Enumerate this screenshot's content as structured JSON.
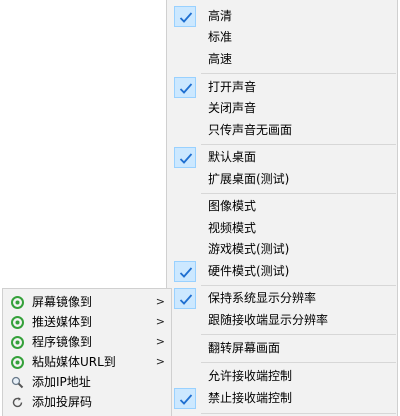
{
  "main_menu": {
    "items": [
      {
        "label": "高清",
        "checked": true
      },
      {
        "label": "标准",
        "checked": false
      },
      {
        "label": "高速",
        "checked": false
      },
      {
        "label": "打开声音",
        "checked": true
      },
      {
        "label": "关闭声音",
        "checked": false
      },
      {
        "label": "只传声音无画面",
        "checked": false
      },
      {
        "label": "默认桌面",
        "checked": true
      },
      {
        "label": "扩展桌面(测试)",
        "checked": false
      },
      {
        "label": "图像模式",
        "checked": false
      },
      {
        "label": "视频模式",
        "checked": false
      },
      {
        "label": "游戏模式(测试)",
        "checked": false
      },
      {
        "label": "硬件模式(测试)",
        "checked": true
      },
      {
        "label": "保持系统显示分辨率",
        "checked": true
      },
      {
        "label": "跟随接收端显示分辨率",
        "checked": false
      },
      {
        "label": "翻转屏幕画面",
        "checked": false
      },
      {
        "label": "允许接收端控制",
        "checked": false
      },
      {
        "label": "禁止接收端控制",
        "checked": true
      }
    ]
  },
  "sub_menu": {
    "items": [
      {
        "label": "屏幕镜像到",
        "icon": "green-share-icon",
        "has_submenu": true
      },
      {
        "label": "推送媒体到",
        "icon": "green-share-icon",
        "has_submenu": true
      },
      {
        "label": "程序镜像到",
        "icon": "green-share-icon",
        "has_submenu": true
      },
      {
        "label": "粘贴媒体URL到",
        "icon": "green-share-icon",
        "has_submenu": true
      },
      {
        "label": "添加IP地址",
        "icon": "magnifier-icon",
        "has_submenu": false
      },
      {
        "label": "添加投屏码",
        "icon": "refresh-icon",
        "has_submenu": false
      }
    ]
  },
  "colors": {
    "menu_bg": "#f2f2f2",
    "check_highlight": "#cce8ff",
    "check_border": "#99d1ff",
    "check_mark": "#1f6fd0",
    "share_icon": "#35a13b"
  }
}
